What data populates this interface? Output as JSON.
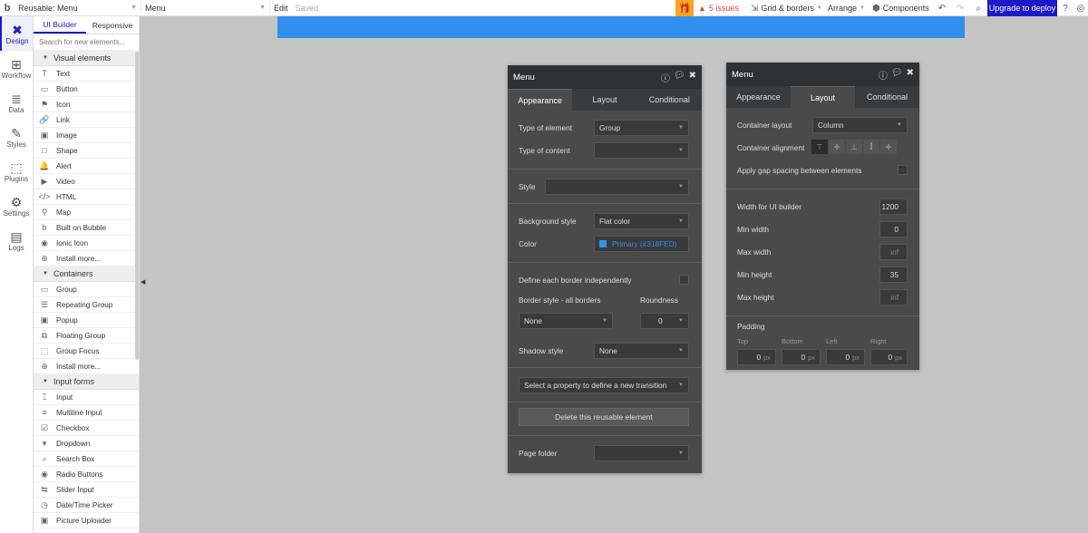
{
  "topbar": {
    "logo": "b",
    "page_selector": "Reusable: Menu",
    "element_selector": "Menu",
    "edit": "Edit",
    "saved": "Saved",
    "issues": "5 issues",
    "grid": "Grid & borders",
    "arrange": "Arrange",
    "components": "Components",
    "upgrade": "Upgrade to deploy"
  },
  "rail": [
    {
      "label": "Design",
      "icon": "✖",
      "active": true
    },
    {
      "label": "Workflow",
      "icon": "⊞"
    },
    {
      "label": "Data",
      "icon": "≣"
    },
    {
      "label": "Styles",
      "icon": "✎"
    },
    {
      "label": "Plugins",
      "icon": "⬚"
    },
    {
      "label": "Settings",
      "icon": "⚙"
    },
    {
      "label": "Logs",
      "icon": "▤"
    }
  ],
  "palette": {
    "tab_builder": "UI Builder",
    "tab_responsive": "Responsive",
    "search_placeholder": "Search for new elements...",
    "sections": [
      {
        "title": "Visual elements",
        "items": [
          {
            "label": "Text",
            "icon": "T"
          },
          {
            "label": "Button",
            "icon": "▭"
          },
          {
            "label": "Icon",
            "icon": "⚑"
          },
          {
            "label": "Link",
            "icon": "🔗"
          },
          {
            "label": "Image",
            "icon": "▣"
          },
          {
            "label": "Shape",
            "icon": "□"
          },
          {
            "label": "Alert",
            "icon": "🔔"
          },
          {
            "label": "Video",
            "icon": "▶"
          },
          {
            "label": "HTML",
            "icon": "</>"
          },
          {
            "label": "Map",
            "icon": "⚲"
          },
          {
            "label": "Built on Bubble",
            "icon": "b"
          },
          {
            "label": "Ionic Icon",
            "icon": "◉"
          },
          {
            "label": "Install more...",
            "icon": "⊕"
          }
        ]
      },
      {
        "title": "Containers",
        "items": [
          {
            "label": "Group",
            "icon": "▭"
          },
          {
            "label": "Repeating Group",
            "icon": "☰"
          },
          {
            "label": "Popup",
            "icon": "▣"
          },
          {
            "label": "Floating Group",
            "icon": "⧉"
          },
          {
            "label": "Group Focus",
            "icon": "⬚"
          },
          {
            "label": "Install more...",
            "icon": "⊕"
          }
        ]
      },
      {
        "title": "Input forms",
        "items": [
          {
            "label": "Input",
            "icon": "⌶"
          },
          {
            "label": "Multiline Input",
            "icon": "≡"
          },
          {
            "label": "Checkbox",
            "icon": "☑"
          },
          {
            "label": "Dropdown",
            "icon": "▾"
          },
          {
            "label": "Search Box",
            "icon": "⌕"
          },
          {
            "label": "Radio Buttons",
            "icon": "◉"
          },
          {
            "label": "Slider Input",
            "icon": "⇆"
          },
          {
            "label": "Date/Time Picker",
            "icon": "◷"
          },
          {
            "label": "Picture Uploader",
            "icon": "▣"
          }
        ]
      }
    ]
  },
  "editor_appearance": {
    "title": "Menu",
    "tabs": [
      "Appearance",
      "Layout",
      "Conditional"
    ],
    "type_of_element_label": "Type of element",
    "type_of_element_value": "Group",
    "type_of_content_label": "Type of content",
    "type_of_content_value": "",
    "style_label": "Style",
    "style_value": "",
    "bg_style_label": "Background style",
    "bg_style_value": "Flat color",
    "color_label": "Color",
    "color_value": "Primary (#318FED)",
    "color_hex": "#318FED",
    "border_each_label": "Define each border independently",
    "border_style_label": "Border style - all borders",
    "roundness_label": "Roundness",
    "border_style_value": "None",
    "roundness_value": "0",
    "shadow_label": "Shadow style",
    "shadow_value": "None",
    "transition_value": "Select a property to define a new transition",
    "delete_label": "Delete this reusable element",
    "page_folder_label": "Page folder",
    "page_folder_value": ""
  },
  "editor_layout": {
    "title": "Menu",
    "tabs": [
      "Appearance",
      "Layout",
      "Conditional"
    ],
    "container_layout_label": "Container layout",
    "container_layout_value": "Column",
    "container_alignment_label": "Container alignment",
    "gap_label": "Apply gap spacing between elements",
    "width_label": "Width for UI builder",
    "width_value": "1200",
    "min_width_label": "Min width",
    "min_width_value": "0",
    "max_width_label": "Max width",
    "max_width_value": "inf",
    "min_height_label": "Min height",
    "min_height_value": "35",
    "max_height_label": "Max height",
    "max_height_value": "inf",
    "padding_label": "Padding",
    "padding": [
      {
        "label": "Top",
        "value": "0"
      },
      {
        "label": "Bottom",
        "value": "0"
      },
      {
        "label": "Left",
        "value": "0"
      },
      {
        "label": "Right",
        "value": "0"
      }
    ],
    "padding_unit": "px"
  }
}
